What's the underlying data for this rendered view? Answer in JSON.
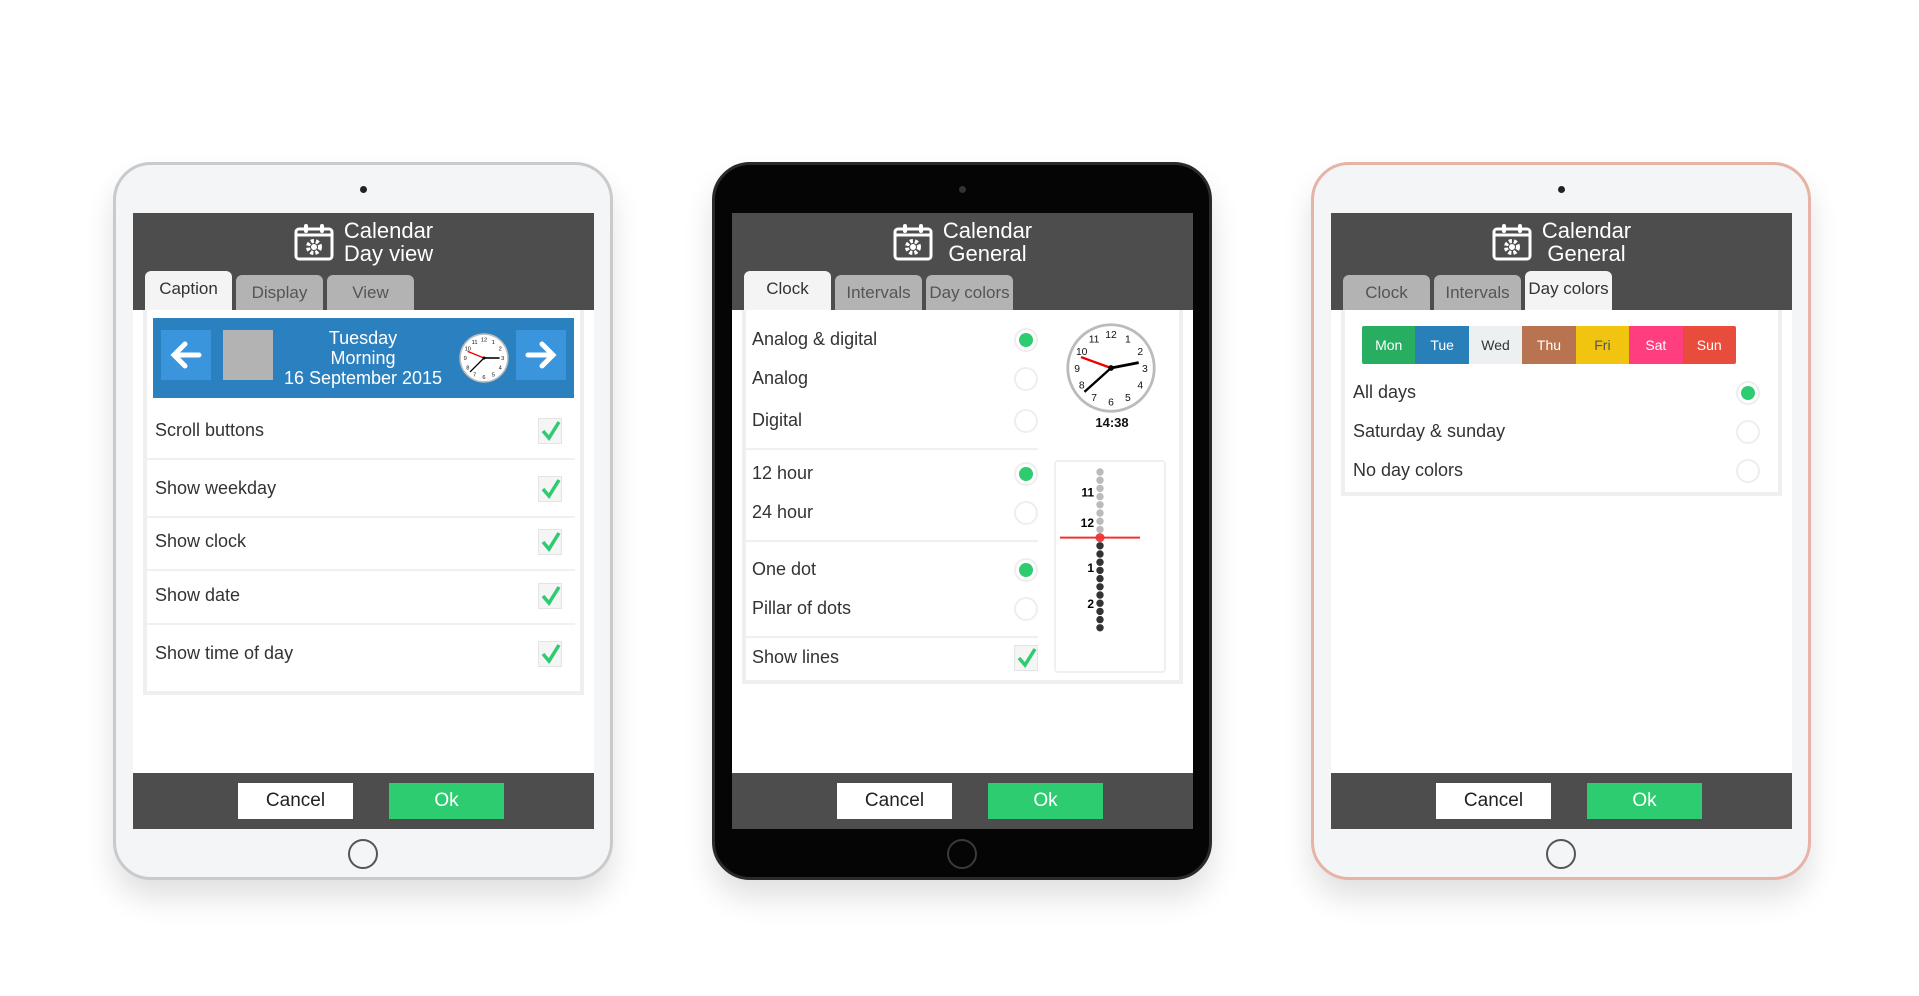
{
  "tablets": [
    {
      "title": "Calendar",
      "subtitle": "Day view",
      "tabs": [
        "Caption",
        "Display",
        "View"
      ],
      "banner": {
        "weekday": "Tuesday",
        "time_of_day": "Morning",
        "date": "16 September 2015"
      },
      "rows": [
        {
          "label": "Scroll buttons",
          "checked": true
        },
        {
          "label": "Show weekday",
          "checked": true
        },
        {
          "label": "Show clock",
          "checked": true
        },
        {
          "label": "Show date",
          "checked": true
        },
        {
          "label": "Show time of day",
          "checked": true
        }
      ],
      "cancel": "Cancel",
      "ok": "Ok"
    },
    {
      "title": "Calendar",
      "subtitle": "General",
      "tabs": [
        "Clock",
        "Intervals",
        "Day colors"
      ],
      "rows": [
        {
          "label": "Analog & digital",
          "selected": true
        },
        {
          "label": "Analog",
          "selected": false
        },
        {
          "label": "Digital",
          "selected": false
        },
        {
          "label": "12 hour",
          "selected": true
        },
        {
          "label": "24 hour",
          "selected": false
        },
        {
          "label": "One dot",
          "selected": true
        },
        {
          "label": "Pillar of dots",
          "selected": false
        },
        {
          "label": "Show lines",
          "checked": true
        }
      ],
      "digital_time": "14:38",
      "pillar_labels": [
        "11",
        "12",
        "1",
        "2"
      ],
      "cancel": "Cancel",
      "ok": "Ok"
    },
    {
      "title": "Calendar",
      "subtitle": "General",
      "tabs": [
        "Clock",
        "Intervals",
        "Day colors"
      ],
      "days": [
        {
          "label": "Mon",
          "color": "#27ae60"
        },
        {
          "label": "Tue",
          "color": "#2980b9"
        },
        {
          "label": "Wed",
          "color": "#ecf0f1"
        },
        {
          "label": "Thu",
          "color": "#b87350"
        },
        {
          "label": "Fri",
          "color": "#f1c40f"
        },
        {
          "label": "Sat",
          "color": "#ff3e80"
        },
        {
          "label": "Sun",
          "color": "#e74c3c"
        }
      ],
      "rows": [
        {
          "label": "All days",
          "selected": true
        },
        {
          "label": "Saturday & sunday",
          "selected": false
        },
        {
          "label": "No day colors",
          "selected": false
        }
      ],
      "cancel": "Cancel",
      "ok": "Ok"
    }
  ],
  "clock_numbers": [
    "12",
    "1",
    "2",
    "3",
    "4",
    "5",
    "6",
    "7",
    "8",
    "9",
    "10",
    "11"
  ],
  "colors": {
    "accent": "#2ecc71",
    "header": "#4d4d4d",
    "banner": "#2b80c0"
  }
}
